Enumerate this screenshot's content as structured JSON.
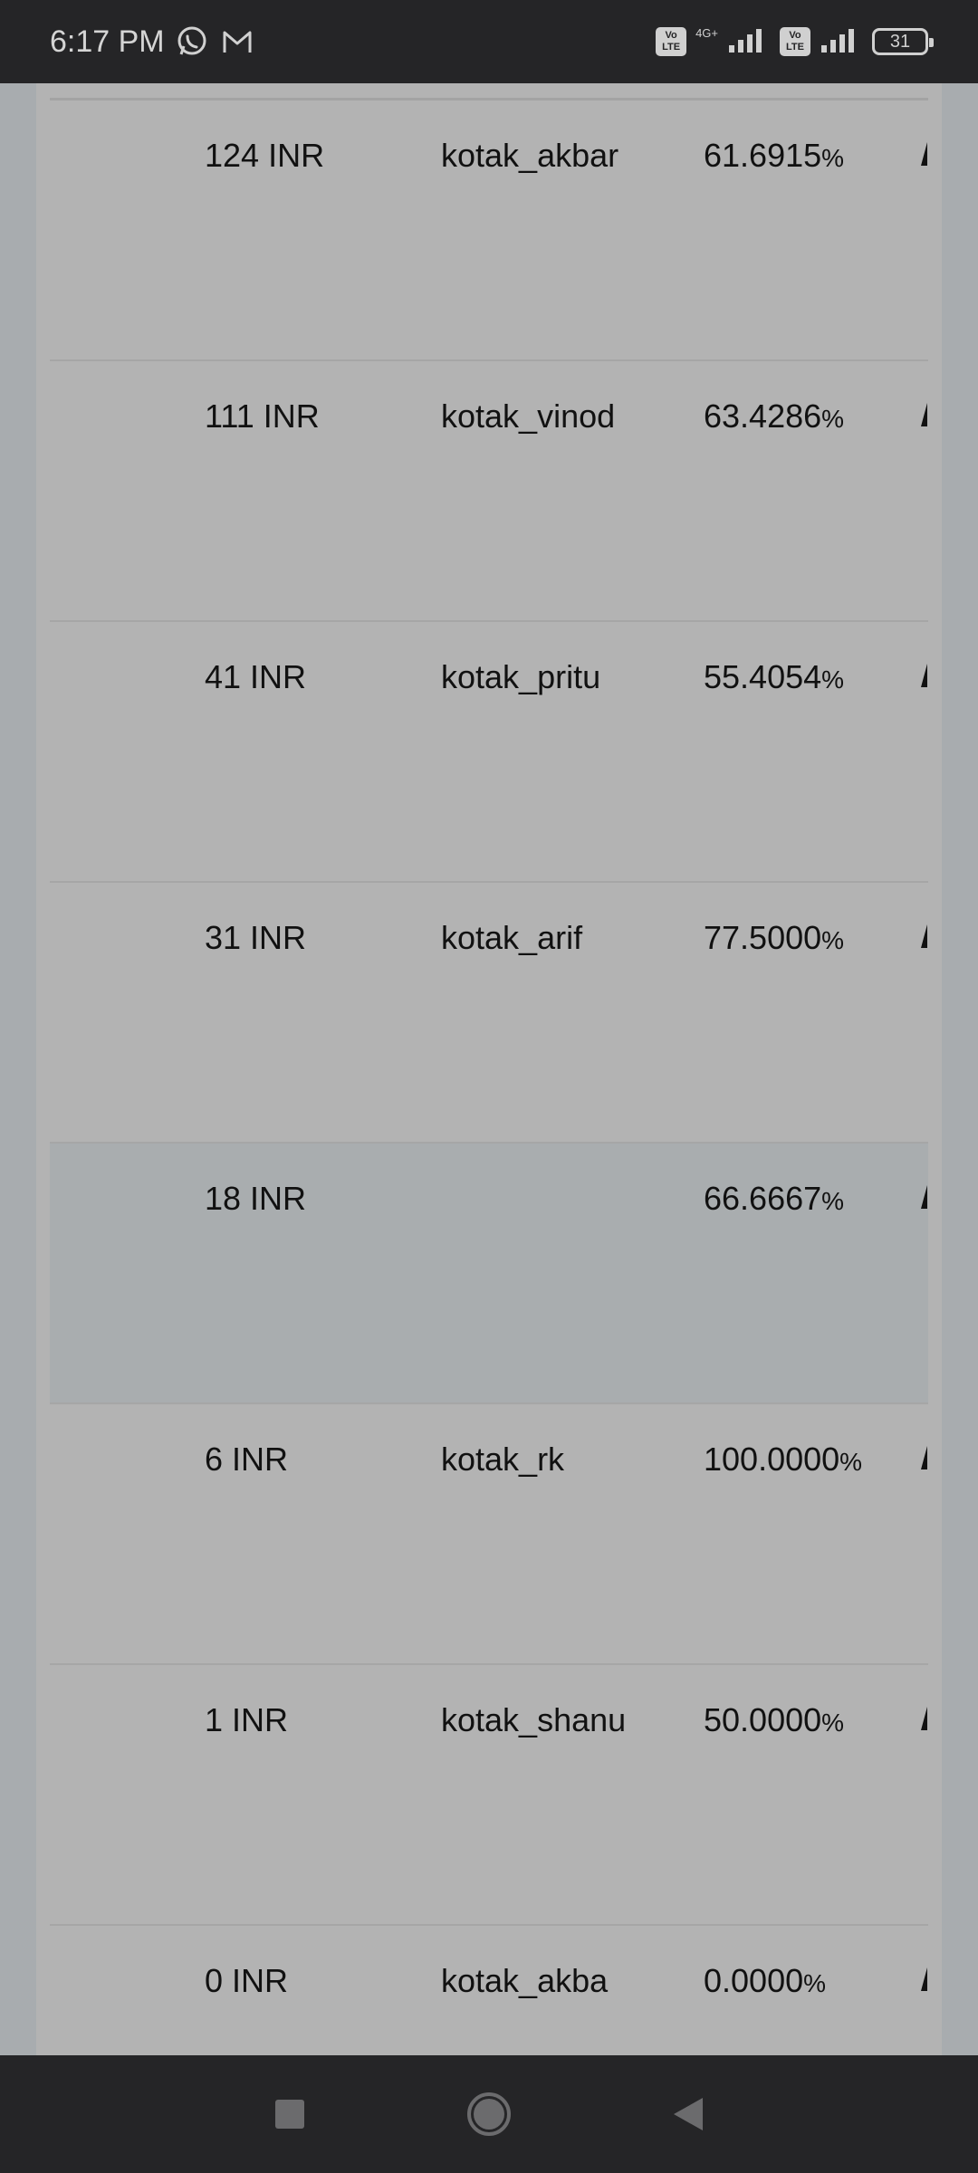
{
  "status_bar": {
    "time": "6:17 PM",
    "network_label": "4G+",
    "volte_label": "Vo LTE",
    "battery_level": "31"
  },
  "table": {
    "rows": [
      {
        "amount": "124 INR",
        "user": "kotak_akbar",
        "rate": "61.6915",
        "rate_unit": "%",
        "highlighted": false
      },
      {
        "amount": "111 INR",
        "user": "kotak_vinod",
        "rate": "63.4286",
        "rate_unit": "%",
        "highlighted": false
      },
      {
        "amount": "41 INR",
        "user": "kotak_pritu",
        "rate": "55.4054",
        "rate_unit": "%",
        "highlighted": false
      },
      {
        "amount": "31 INR",
        "user": "kotak_arif",
        "rate": "77.5000",
        "rate_unit": "%",
        "highlighted": false
      },
      {
        "amount": "18 INR",
        "user": "",
        "rate": "66.6667",
        "rate_unit": "%",
        "highlighted": true
      },
      {
        "amount": "6 INR",
        "user": "kotak_rk",
        "rate": "100.0000",
        "rate_unit": "%",
        "highlighted": false
      },
      {
        "amount": "1 INR",
        "user": "kotak_shanu",
        "rate": "50.0000",
        "rate_unit": "%",
        "highlighted": false
      },
      {
        "amount": "0 INR",
        "user": "kotak_akba",
        "rate": "0.0000",
        "rate_unit": "%",
        "highlighted": false
      }
    ]
  },
  "nav": {
    "icons": [
      "recents-square-icon",
      "home-circle-icon",
      "back-triangle-icon"
    ]
  }
}
